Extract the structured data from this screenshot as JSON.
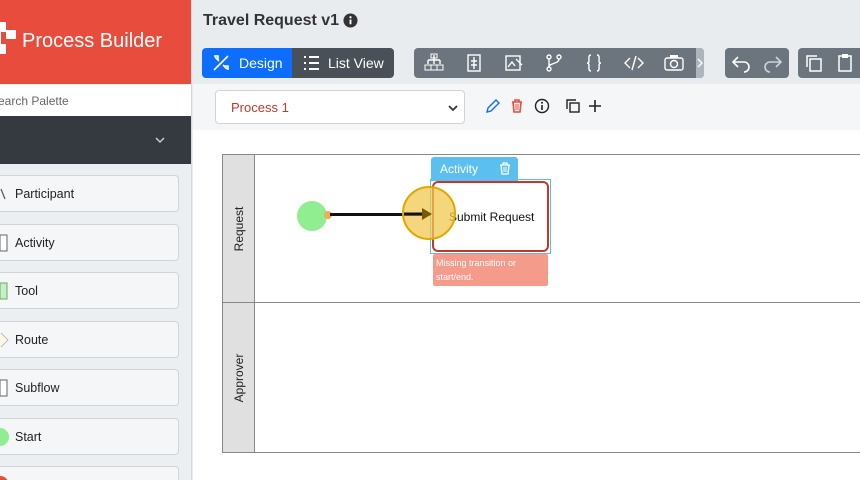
{
  "app": {
    "brand": "Process Builder",
    "title": "Travel Request v1"
  },
  "sidebar": {
    "search_placeholder": "Search Palette",
    "items": [
      {
        "label": "Participant",
        "icon": "participant-icon"
      },
      {
        "label": "Activity",
        "icon": "activity-icon"
      },
      {
        "label": "Tool",
        "icon": "tool-icon"
      },
      {
        "label": "Route",
        "icon": "route-icon"
      },
      {
        "label": "Subflow",
        "icon": "subflow-icon"
      },
      {
        "label": "Start",
        "icon": "start-icon"
      },
      {
        "label": "",
        "icon": "end-icon"
      }
    ]
  },
  "toolbar": {
    "design_label": "Design",
    "list_view_label": "List View"
  },
  "process": {
    "selected": "Process 1"
  },
  "canvas": {
    "lanes": [
      {
        "label": "Request"
      },
      {
        "label": "Approver"
      }
    ],
    "activity": {
      "tab_label": "Activity",
      "name": "Submit Request",
      "error": "Missing transition or start/end."
    }
  },
  "colors": {
    "brand": "#e74c3c",
    "primary": "#0d6efd",
    "toolbar_gray": "#6c757d",
    "error": "#f59b8c",
    "start": "#90ee90"
  }
}
